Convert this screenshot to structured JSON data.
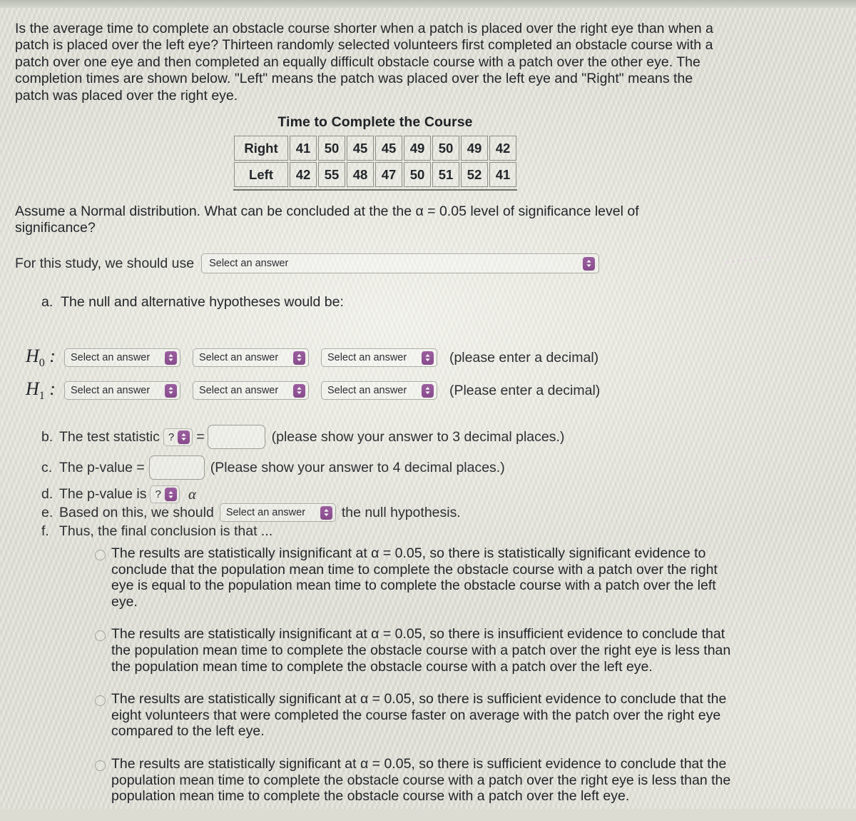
{
  "intro": {
    "paragraph": "Is the average time to complete an obstacle course shorter when a patch is placed over the right eye than when a patch is placed over the left eye? Thirteen randomly selected volunteers first completed an obstacle course with a patch over one eye and then completed an equally difficult obstacle course with a patch over the other eye. The completion times are shown below. \"Left\" means the patch was placed over the left eye and \"Right\" means the patch was placed over the right eye."
  },
  "table": {
    "caption": "Time to Complete the Course",
    "rows": [
      {
        "label": "Right",
        "values": [
          "41",
          "50",
          "45",
          "45",
          "49",
          "50",
          "49",
          "42"
        ]
      },
      {
        "label": "Left",
        "values": [
          "42",
          "55",
          "48",
          "47",
          "50",
          "51",
          "52",
          "41"
        ]
      }
    ]
  },
  "assume": {
    "paragraph": "Assume a Normal distribution.  What can be concluded at the the α = 0.05 level of significance level of significance?"
  },
  "study": {
    "lead": "For this study, we should use",
    "select_value": "Select an answer"
  },
  "part_a": {
    "letter": "a.",
    "label": "The null and alternative hypotheses would be:",
    "h0": {
      "name": "H",
      "sub": "0",
      "colon": ":",
      "select1": "Select an answer",
      "select2": "Select an answer",
      "select3": "Select an answer",
      "note": "(please enter a decimal)"
    },
    "h1": {
      "name": "H",
      "sub": "1",
      "colon": ":",
      "select1": "Select an answer",
      "select2": "Select an answer",
      "select3": "Select an answer",
      "note": "(Please enter a decimal)"
    }
  },
  "part_b": {
    "letter": "b.",
    "lead": "The test statistic",
    "qmark": "?",
    "equals": "=",
    "input_value": "",
    "note": "(please show your answer to 3 decimal places.)"
  },
  "part_c": {
    "letter": "c.",
    "lead": "The p-value =",
    "input_value": "",
    "note": "(Please show your answer to 4 decimal places.)"
  },
  "part_d": {
    "letter": "d.",
    "lead": "The p-value is",
    "qmark": "?",
    "alpha": "α"
  },
  "part_e": {
    "letter": "e.",
    "lead": "Based on this, we should",
    "select_value": "Select an answer",
    "trail": "the null hypothesis."
  },
  "part_f": {
    "letter": "f.",
    "lead": "Thus, the final conclusion is that ..."
  },
  "options": [
    {
      "text": "The results are statistically insignificant at α = 0.05, so there is statistically significant evidence to conclude that the population mean time to complete the obstacle course with a patch over the right eye is equal to the population mean time to complete the obstacle course with a patch over the left eye."
    },
    {
      "text": "The results are statistically insignificant at α = 0.05, so there is insufficient evidence to conclude that the population mean time to complete the obstacle course with a patch over the right eye is less than the population mean time to complete the obstacle course with a patch over the left eye."
    },
    {
      "text": "The results are statistically significant at α = 0.05, so there is sufficient evidence to conclude that the eight volunteers that were completed the course faster on average with the patch over the right eye compared to the left eye."
    },
    {
      "text": "The results are statistically significant at α = 0.05, so there is sufficient evidence to conclude that the population mean time to complete the obstacle course with a patch over the right eye is less than the population mean time to complete the obstacle course with a patch over the left eye."
    }
  ],
  "watermark": {
    "text": "••••••••"
  },
  "colors": {
    "page_background": "#dcdcd2",
    "text": "#23262a",
    "select_accent": "#8f5394",
    "control_border": "#a9aca3"
  }
}
